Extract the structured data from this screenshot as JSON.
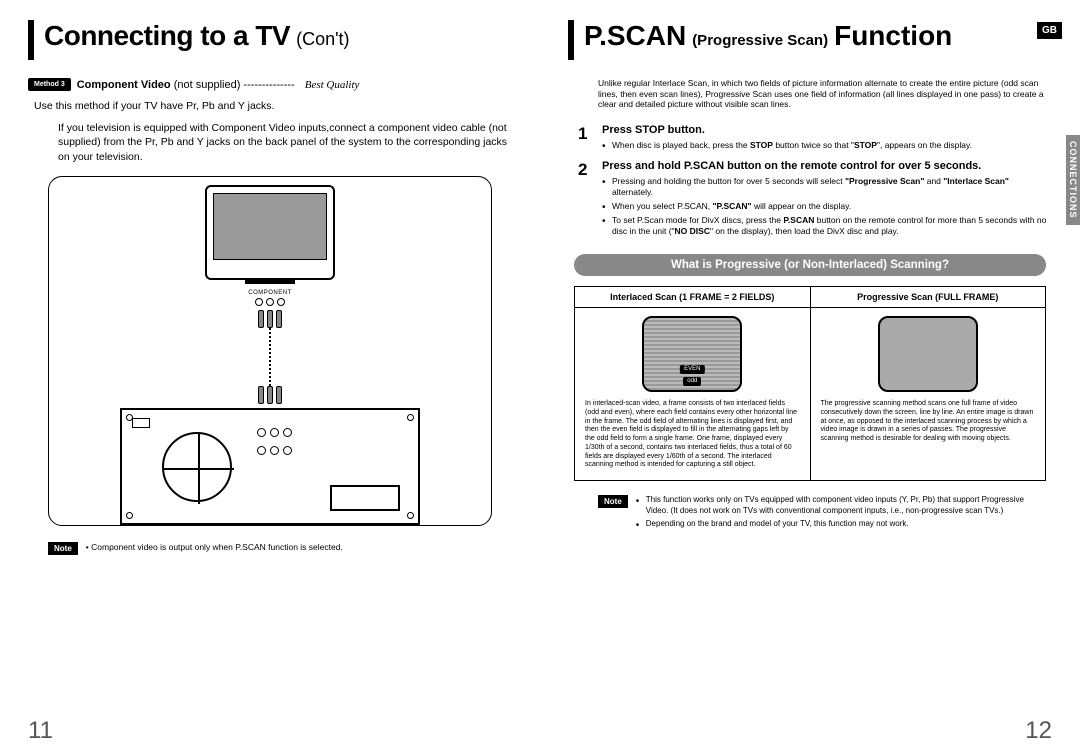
{
  "left": {
    "title_main": "Connecting to a TV",
    "title_sub": "(Con't)",
    "method_pill": "Method 3",
    "method_label_bold": "Component Video",
    "method_label_rest": " (not supplied) ",
    "method_dots": "--------------",
    "best_quality": "Best Quality",
    "line1": "Use this method if your TV have Pr, Pb and Y jacks.",
    "para": "If you television is equipped with Component Video inputs,connect a component video cable (not supplied) from the Pr, Pb and Y jacks on the back panel of the system to the corresponding jacks on your television.",
    "component_label": "COMPONENT",
    "note_label": "Note",
    "note_text": "• Component video is output only when P.SCAN function is selected.",
    "page_num": "11"
  },
  "right": {
    "gb": "GB",
    "side_tab": "CONNECTIONS",
    "title_a": "P.SCAN",
    "title_b": "(Progressive Scan)",
    "title_c": " Function",
    "intro": "Unlike regular Interlace Scan, in which two fields of picture information alternate to create the entire picture (odd scan lines, then even scan lines), Progressive Scan uses one field of information (all lines displayed in one pass) to create a clear and detailed picture without visible scan lines.",
    "step1_num": "1",
    "step1_title": "Press STOP button.",
    "step1_b1_a": "When disc is played back, press the ",
    "step1_b1_b": "STOP",
    "step1_b1_c": " button twice so that \"",
    "step1_b1_d": "STOP",
    "step1_b1_e": "\", appears on the display.",
    "step2_num": "2",
    "step2_title": "Press and hold P.SCAN button on the remote control for over 5 seconds.",
    "step2_b1_a": "Pressing and holding the button for over 5 seconds will select ",
    "step2_b1_b": "\"Progressive Scan\"",
    "step2_b1_c": " and ",
    "step2_b1_d": "\"Interlace Scan\"",
    "step2_b1_e": " alternately.",
    "step2_b2_a": "When you select P.SCAN, ",
    "step2_b2_b": "\"P.SCAN\"",
    "step2_b2_c": " will appear on the display.",
    "step2_b3_a": "To set P.Scan mode for DivX discs, press the ",
    "step2_b3_b": "P.SCAN",
    "step2_b3_c": " button on the remote control for more than 5 seconds with no disc in the unit (\"",
    "step2_b3_d": "NO DISC",
    "step2_b3_e": "\" on the display), then load the DivX disc and play.",
    "section_bar": "What is Progressive (or Non-Interlaced) Scanning?",
    "th1": "Interlaced Scan (1 FRAME = 2 FIELDS)",
    "th2": "Progressive Scan (FULL FRAME)",
    "mini_even": "EVEN",
    "mini_odd": "odd",
    "cell1": "In interlaced-scan video, a frame consists of two interlaced fields (odd and even), where each field contains every other horizontal line in the frame. The odd field of alternating lines is displayed first, and then the even field is displayed to fill in the alternating gaps left by the odd field to form a single frame. One frame, displayed every 1/30th of a second, contains two interlaced fields, thus a total of 60 fields are displayed every 1/60th of a second. The interlaced scanning method is intended for capturing a still object.",
    "cell2": "The progressive scanning method scans one full frame of video consecutively down the screen, line by line. An entire image is drawn at once, as opposed to the interlaced scanning process by which a video image is drawn in a series of passes. The progressive scanning method is desirable for dealing with moving objects.",
    "note_label": "Note",
    "note_b1": "This function works only on TVs equipped with component video inputs (Y, Pr, Pb) that support Progressive Video. (It does not work on TVs with conventional component inputs, i.e., non-progressive scan TVs.)",
    "note_b2": "Depending on the brand and model of your TV, this function may not work.",
    "page_num": "12"
  }
}
